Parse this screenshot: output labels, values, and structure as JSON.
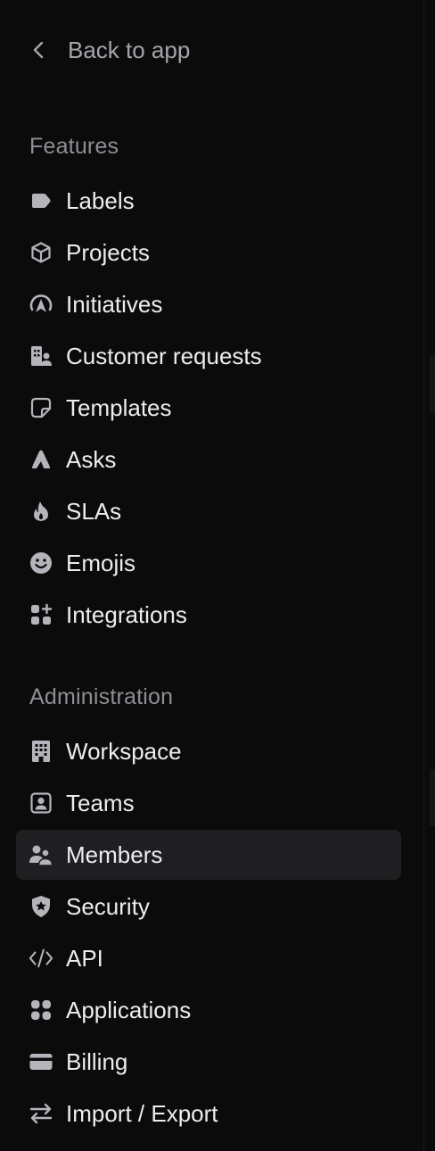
{
  "back": {
    "label": "Back to app",
    "icon": "chevron-left-icon"
  },
  "features": {
    "title": "Features",
    "items": [
      {
        "label": "Labels",
        "icon": "tag-icon"
      },
      {
        "label": "Projects",
        "icon": "cube-icon"
      },
      {
        "label": "Initiatives",
        "icon": "initiatives-icon"
      },
      {
        "label": "Customer requests",
        "icon": "customer-requests-icon"
      },
      {
        "label": "Templates",
        "icon": "sticky-note-icon"
      },
      {
        "label": "Asks",
        "icon": "asks-icon"
      },
      {
        "label": "SLAs",
        "icon": "flame-icon"
      },
      {
        "label": "Emojis",
        "icon": "smiley-icon"
      },
      {
        "label": "Integrations",
        "icon": "grid-plus-icon"
      }
    ]
  },
  "administration": {
    "title": "Administration",
    "items": [
      {
        "label": "Workspace",
        "icon": "building-icon"
      },
      {
        "label": "Teams",
        "icon": "team-card-icon"
      },
      {
        "label": "Members",
        "icon": "people-icon",
        "active": true
      },
      {
        "label": "Security",
        "icon": "shield-star-icon"
      },
      {
        "label": "API",
        "icon": "code-icon"
      },
      {
        "label": "Applications",
        "icon": "apps-icon"
      },
      {
        "label": "Billing",
        "icon": "credit-card-icon"
      },
      {
        "label": "Import / Export",
        "icon": "arrows-swap-icon"
      }
    ]
  },
  "colors": {
    "background": "#0b0b0c",
    "active_item_bg": "#1f1f22",
    "text": "#ededf0",
    "muted": "#8e8e94",
    "icon": "#b4b4ba"
  }
}
